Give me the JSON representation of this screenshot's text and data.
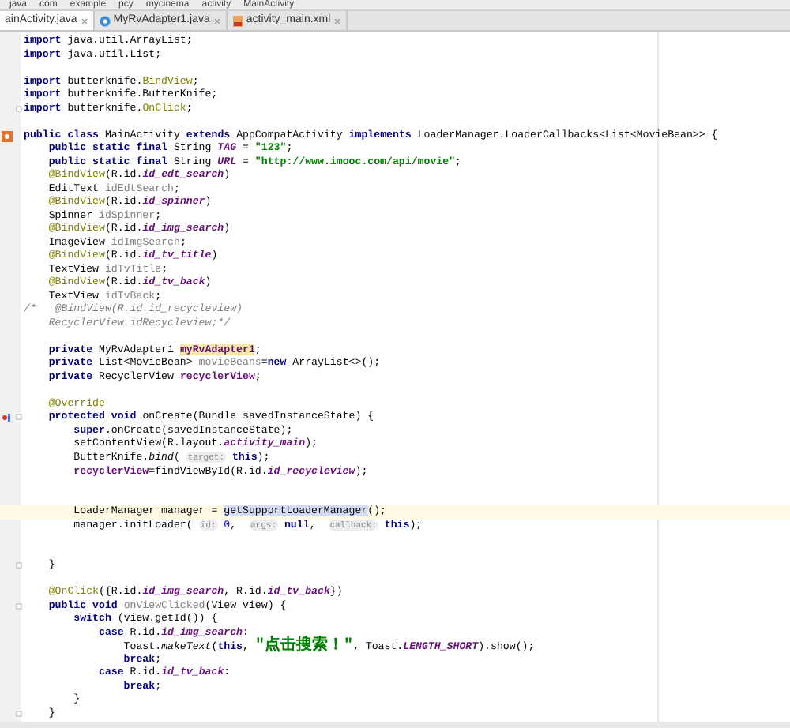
{
  "breadcrumb": [
    "java",
    "com",
    "example",
    "pcy",
    "mycinema",
    "activity",
    "MainActivity"
  ],
  "tabs": [
    {
      "label": "ainActivity.java",
      "selected": true,
      "kind": "none"
    },
    {
      "label": "MyRvAdapter1.java",
      "selected": false,
      "kind": "class"
    },
    {
      "label": "activity_main.xml",
      "selected": false,
      "kind": "xml"
    }
  ],
  "lines": [
    {
      "current": false,
      "tokens": [
        {
          "kind": "kw",
          "text": "import "
        },
        {
          "kind": "plain",
          "text": "java.util.ArrayList;"
        }
      ]
    },
    {
      "current": false,
      "tokens": [
        {
          "kind": "kw",
          "text": "import "
        },
        {
          "kind": "plain",
          "text": "java.util.List;"
        }
      ]
    },
    {
      "current": false
    },
    {
      "current": false,
      "tokens": [
        {
          "kind": "kw",
          "text": "import "
        },
        {
          "kind": "plain",
          "text": "butterknife."
        },
        {
          "kind": "ann",
          "text": "BindView"
        },
        {
          "kind": "plain",
          "text": ";"
        }
      ]
    },
    {
      "current": false,
      "tokens": [
        {
          "kind": "kw",
          "text": "import "
        },
        {
          "kind": "plain",
          "text": "butterknife.ButterKnife;"
        }
      ]
    },
    {
      "current": false,
      "fold": true,
      "tokens": [
        {
          "kind": "kw",
          "text": "import "
        },
        {
          "kind": "plain",
          "text": "butterknife."
        },
        {
          "kind": "ann",
          "text": "OnClick"
        },
        {
          "kind": "plain",
          "text": ";"
        }
      ]
    },
    {
      "current": false
    },
    {
      "current": false,
      "kind": "class",
      "tokens": [
        {
          "kind": "kw",
          "text": "public class "
        },
        {
          "kind": "plain",
          "text": "MainActivity "
        },
        {
          "kind": "kw",
          "text": "extends "
        },
        {
          "kind": "plain",
          "text": "AppCompatActivity "
        },
        {
          "kind": "kw",
          "text": "implements "
        },
        {
          "kind": "plain",
          "text": "LoaderManager.LoaderCallbacks<List<MovieBean>> {"
        }
      ]
    },
    {
      "current": false,
      "tokens": [
        {
          "kind": "kw",
          "text": "    public static final "
        },
        {
          "kind": "plain",
          "text": "String "
        },
        {
          "kind": "const",
          "text": "TAG"
        },
        {
          "kind": "plain",
          "text": " = "
        },
        {
          "kind": "str",
          "text": "\"123\""
        },
        {
          "kind": "plain",
          "text": ";"
        }
      ]
    },
    {
      "current": false,
      "tokens": [
        {
          "kind": "kw",
          "text": "    public static final "
        },
        {
          "kind": "plain",
          "text": "String "
        },
        {
          "kind": "const",
          "text": "URL"
        },
        {
          "kind": "plain",
          "text": " = "
        },
        {
          "kind": "str",
          "text": "\"http://www.imooc.com/api/movie\""
        },
        {
          "kind": "plain",
          "text": ";"
        }
      ]
    },
    {
      "current": false,
      "tokens": [
        {
          "kind": "ann",
          "text": "    @BindView"
        },
        {
          "kind": "plain",
          "text": "(R.id."
        },
        {
          "kind": "field",
          "text": "id_edt_search"
        },
        {
          "kind": "plain",
          "text": ")"
        }
      ]
    },
    {
      "current": false,
      "tokens": [
        {
          "kind": "plain",
          "text": "    EditText "
        },
        {
          "kind": "unused",
          "text": "idEdtSearch"
        },
        {
          "kind": "plain",
          "text": ";"
        }
      ]
    },
    {
      "current": false,
      "tokens": [
        {
          "kind": "ann",
          "text": "    @BindView"
        },
        {
          "kind": "plain",
          "text": "(R.id."
        },
        {
          "kind": "field",
          "text": "id_spinner"
        },
        {
          "kind": "plain",
          "text": ")"
        }
      ]
    },
    {
      "current": false,
      "tokens": [
        {
          "kind": "plain",
          "text": "    Spinner "
        },
        {
          "kind": "unused",
          "text": "idSpinner"
        },
        {
          "kind": "plain",
          "text": ";"
        }
      ]
    },
    {
      "current": false,
      "tokens": [
        {
          "kind": "ann",
          "text": "    @BindView"
        },
        {
          "kind": "plain",
          "text": "(R.id."
        },
        {
          "kind": "field",
          "text": "id_img_search"
        },
        {
          "kind": "plain",
          "text": ")"
        }
      ]
    },
    {
      "current": false,
      "tokens": [
        {
          "kind": "plain",
          "text": "    ImageView "
        },
        {
          "kind": "unused",
          "text": "idImgSearch"
        },
        {
          "kind": "plain",
          "text": ";"
        }
      ]
    },
    {
      "current": false,
      "tokens": [
        {
          "kind": "ann",
          "text": "    @BindView"
        },
        {
          "kind": "plain",
          "text": "(R.id."
        },
        {
          "kind": "field",
          "text": "id_tv_title"
        },
        {
          "kind": "plain",
          "text": ")"
        }
      ]
    },
    {
      "current": false,
      "tokens": [
        {
          "kind": "plain",
          "text": "    TextView "
        },
        {
          "kind": "unused",
          "text": "idTvTitle"
        },
        {
          "kind": "plain",
          "text": ";"
        }
      ]
    },
    {
      "current": false,
      "tokens": [
        {
          "kind": "ann",
          "text": "    @BindView"
        },
        {
          "kind": "plain",
          "text": "(R.id."
        },
        {
          "kind": "field",
          "text": "id_tv_back"
        },
        {
          "kind": "plain",
          "text": ")"
        }
      ]
    },
    {
      "current": false,
      "tokens": [
        {
          "kind": "plain",
          "text": "    TextView "
        },
        {
          "kind": "unused",
          "text": "idTvBack"
        },
        {
          "kind": "plain",
          "text": ";"
        }
      ]
    },
    {
      "current": false,
      "tokens": [
        {
          "kind": "comment",
          "text": "/*   @BindView(R.id.id_recycleview)"
        }
      ]
    },
    {
      "current": false,
      "tokens": [
        {
          "kind": "comment",
          "text": "    RecyclerView idRecycleview;*/"
        }
      ]
    },
    {
      "current": false
    },
    {
      "current": false,
      "tokens": [
        {
          "kind": "kw",
          "text": "    private "
        },
        {
          "kind": "plain",
          "text": "MyRvAdapter1 "
        },
        {
          "kind": "mark",
          "text": "myRvAdapter1"
        },
        {
          "kind": "plain",
          "text": ";"
        }
      ]
    },
    {
      "current": false,
      "tokens": [
        {
          "kind": "kw",
          "text": "    private "
        },
        {
          "kind": "plain",
          "text": "List<MovieBean> "
        },
        {
          "kind": "unused",
          "text": "movieBeans"
        },
        {
          "kind": "plain",
          "text": "="
        },
        {
          "kind": "kw",
          "text": "new "
        },
        {
          "kind": "plain",
          "text": "ArrayList<>();"
        }
      ]
    },
    {
      "current": false,
      "tokens": [
        {
          "kind": "kw",
          "text": "    private "
        },
        {
          "kind": "plain",
          "text": "RecyclerView "
        },
        {
          "kind": "member",
          "text": "recyclerView"
        },
        {
          "kind": "plain",
          "text": ";"
        }
      ]
    },
    {
      "current": false
    },
    {
      "current": false,
      "tokens": [
        {
          "kind": "ann",
          "text": "    @Override"
        }
      ]
    },
    {
      "current": false,
      "kind": "override",
      "fold": true,
      "tokens": [
        {
          "kind": "kw",
          "text": "    protected void "
        },
        {
          "kind": "plain",
          "text": "onCreate(Bundle savedInstanceState) {"
        }
      ]
    },
    {
      "current": false,
      "tokens": [
        {
          "kind": "kw",
          "text": "        super"
        },
        {
          "kind": "plain",
          "text": ".onCreate(savedInstanceState);"
        }
      ]
    },
    {
      "current": false,
      "tokens": [
        {
          "kind": "plain",
          "text": "        setContentView(R.layout."
        },
        {
          "kind": "field",
          "text": "activity_main"
        },
        {
          "kind": "plain",
          "text": ");"
        }
      ]
    },
    {
      "current": false,
      "tokens": [
        {
          "kind": "plain",
          "text": "        ButterKnife."
        },
        {
          "kind": "italic",
          "text": "bind"
        },
        {
          "kind": "plain",
          "text": "( "
        },
        {
          "kind": "hint",
          "text": "target:"
        },
        {
          "kind": "kw",
          "text": " this"
        },
        {
          "kind": "plain",
          "text": ");"
        }
      ]
    },
    {
      "current": false,
      "tokens": [
        {
          "kind": "member",
          "text": "        recyclerView"
        },
        {
          "kind": "plain",
          "text": "=findViewById(R.id."
        },
        {
          "kind": "field",
          "text": "id_recycleview"
        },
        {
          "kind": "plain",
          "text": ");"
        }
      ]
    },
    {
      "current": false
    },
    {
      "current": false
    },
    {
      "current": true,
      "tokens": [
        {
          "kind": "plain",
          "text": "        LoaderManager manager = "
        },
        {
          "kind": "sel",
          "text": "getSupportLoaderManager"
        },
        {
          "kind": "plain",
          "text": "();"
        }
      ]
    },
    {
      "current": false,
      "tokens": [
        {
          "kind": "plain",
          "text": "        manager.initLoader( "
        },
        {
          "kind": "hint",
          "text": "id:"
        },
        {
          "kind": "num",
          "text": " 0"
        },
        {
          "kind": "plain",
          "text": ",  "
        },
        {
          "kind": "hint",
          "text": "args:"
        },
        {
          "kind": "kw",
          "text": " null"
        },
        {
          "kind": "plain",
          "text": ",  "
        },
        {
          "kind": "hint",
          "text": "callback:"
        },
        {
          "kind": "kw",
          "text": " this"
        },
        {
          "kind": "plain",
          "text": ");"
        }
      ]
    },
    {
      "current": false
    },
    {
      "current": false
    },
    {
      "current": false,
      "fold": true,
      "tokens": [
        {
          "kind": "plain",
          "text": "    }"
        }
      ]
    },
    {
      "current": false
    },
    {
      "current": false,
      "tokens": [
        {
          "kind": "ann",
          "text": "    @OnClick"
        },
        {
          "kind": "plain",
          "text": "({R.id."
        },
        {
          "kind": "field",
          "text": "id_img_search"
        },
        {
          "kind": "plain",
          "text": ", R.id."
        },
        {
          "kind": "field",
          "text": "id_tv_back"
        },
        {
          "kind": "plain",
          "text": "})"
        }
      ]
    },
    {
      "current": false,
      "fold": true,
      "tokens": [
        {
          "kind": "kw",
          "text": "    public void "
        },
        {
          "kind": "unused",
          "text": "onViewClicked"
        },
        {
          "kind": "plain",
          "text": "(View view) {"
        }
      ]
    },
    {
      "current": false,
      "tokens": [
        {
          "kind": "kw",
          "text": "        switch "
        },
        {
          "kind": "plain",
          "text": "(view.getId()) {"
        }
      ]
    },
    {
      "current": false,
      "tokens": [
        {
          "kind": "kw",
          "text": "            case "
        },
        {
          "kind": "plain",
          "text": "R.id."
        },
        {
          "kind": "field",
          "text": "id_img_search"
        },
        {
          "kind": "plain",
          "text": ":"
        }
      ]
    },
    {
      "current": false,
      "tokens": [
        {
          "kind": "plain",
          "text": "                Toast."
        },
        {
          "kind": "italic",
          "text": "makeText"
        },
        {
          "kind": "plain",
          "text": "("
        },
        {
          "kind": "kw",
          "text": "this"
        },
        {
          "kind": "plain",
          "text": ", "
        },
        {
          "kind": "strcjk",
          "text": "\"点击搜索！\""
        },
        {
          "kind": "plain",
          "text": ", Toast."
        },
        {
          "kind": "field",
          "text": "LENGTH_SHORT"
        },
        {
          "kind": "plain",
          "text": ").show();"
        }
      ]
    },
    {
      "current": false,
      "tokens": [
        {
          "kind": "kw",
          "text": "                break"
        },
        {
          "kind": "plain",
          "text": ";"
        }
      ]
    },
    {
      "current": false,
      "tokens": [
        {
          "kind": "kw",
          "text": "            case "
        },
        {
          "kind": "plain",
          "text": "R.id."
        },
        {
          "kind": "field",
          "text": "id_tv_back"
        },
        {
          "kind": "plain",
          "text": ":"
        }
      ]
    },
    {
      "current": false,
      "tokens": [
        {
          "kind": "kw",
          "text": "                break"
        },
        {
          "kind": "plain",
          "text": ";"
        }
      ]
    },
    {
      "current": false,
      "tokens": [
        {
          "kind": "plain",
          "text": "        }"
        }
      ]
    },
    {
      "current": false,
      "fold": true,
      "tokens": [
        {
          "kind": "plain",
          "text": "    }"
        }
      ]
    }
  ]
}
